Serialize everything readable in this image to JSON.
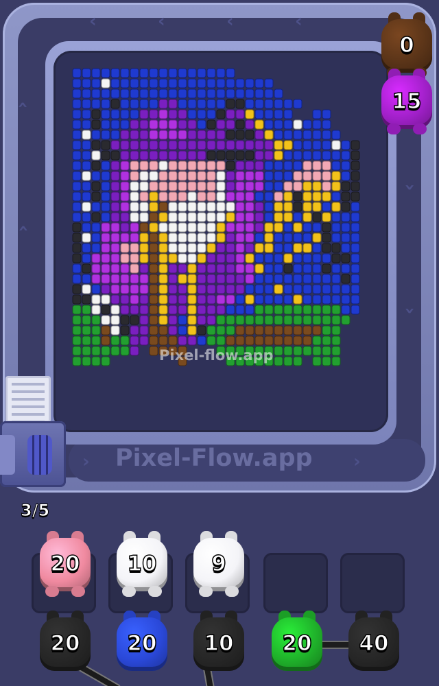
{
  "watermark_board": "Pixel-flow.app",
  "watermark_track": "Pixel-Flow.app",
  "progress": "3/5",
  "active_shooters": [
    {
      "color": "#5a3418",
      "count": "0"
    },
    {
      "color": "#a020c8",
      "count": "15"
    }
  ],
  "queue": [
    {
      "color": "#f08aa0",
      "count": "20"
    },
    {
      "color": "#f4f4f8",
      "count": "10"
    },
    {
      "color": "#f4f4f8",
      "count": "9"
    }
  ],
  "grid_pigs": [
    {
      "color": "#262626",
      "count": "20"
    },
    {
      "color": "#2a48d8",
      "count": "20"
    },
    {
      "color": "#262626",
      "count": "10"
    },
    {
      "color": "#1fb02a",
      "count": "20"
    },
    {
      "color": "#262626",
      "count": "40"
    }
  ],
  "palette": {
    "K": "#2a2a2f",
    "B": "#1f3ad0",
    "P": "#7a1fc0",
    "M": "#b031e0",
    "W": "#f4f4f4",
    "S": "#f2a8b4",
    "Y": "#f2c21a",
    "G": "#22a030",
    "R": "#7a4a1e",
    "D": "#1b1b28"
  }
}
